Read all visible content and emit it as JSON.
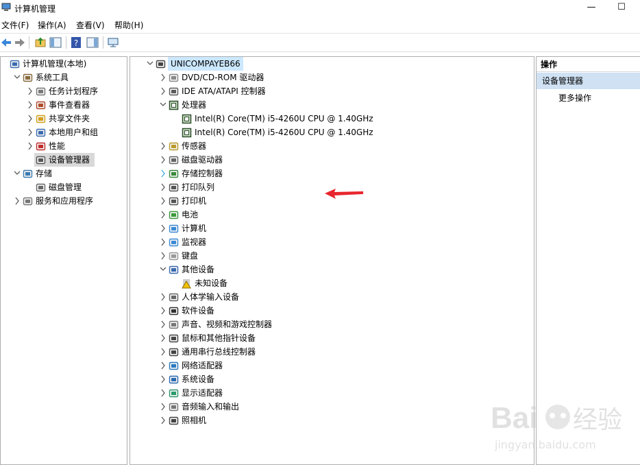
{
  "window": {
    "title": "计算机管理",
    "minimize_glyph": "—",
    "maximize_glyph": "☐"
  },
  "menu": [
    "文件(F)",
    "操作(A)",
    "查看(V)",
    "帮助(H)"
  ],
  "left_tree": [
    {
      "label": "计算机管理(本地)",
      "icon": "computer-management-icon",
      "level": 0,
      "chevron": "none"
    },
    {
      "label": "系统工具",
      "icon": "tools-icon",
      "level": 1,
      "chevron": "down"
    },
    {
      "label": "任务计划程序",
      "icon": "clock-icon",
      "level": 2,
      "chevron": "right"
    },
    {
      "label": "事件查看器",
      "icon": "event-viewer-icon",
      "level": 2,
      "chevron": "right"
    },
    {
      "label": "共享文件夹",
      "icon": "shared-folder-icon",
      "level": 2,
      "chevron": "right"
    },
    {
      "label": "本地用户和组",
      "icon": "users-icon",
      "level": 2,
      "chevron": "right"
    },
    {
      "label": "性能",
      "icon": "performance-icon",
      "level": 2,
      "chevron": "right"
    },
    {
      "label": "设备管理器",
      "icon": "device-manager-icon",
      "level": 2,
      "chevron": "none",
      "selected": true
    },
    {
      "label": "存储",
      "icon": "storage-icon",
      "level": 1,
      "chevron": "down"
    },
    {
      "label": "磁盘管理",
      "icon": "disk-management-icon",
      "level": 2,
      "chevron": "none"
    },
    {
      "label": "服务和应用程序",
      "icon": "services-icon",
      "level": 1,
      "chevron": "right"
    }
  ],
  "device_tree": [
    {
      "label": "UNICOMPAYEB66",
      "icon": "computer-network-icon",
      "level": 0,
      "chevron": "down",
      "host": true
    },
    {
      "label": "DVD/CD-ROM 驱动器",
      "icon": "dvd-icon",
      "level": 1,
      "chevron": "right"
    },
    {
      "label": "IDE ATA/ATAPI 控制器",
      "icon": "ide-controller-icon",
      "level": 1,
      "chevron": "right"
    },
    {
      "label": "处理器",
      "icon": "processor-icon",
      "level": 1,
      "chevron": "down"
    },
    {
      "label": "Intel(R) Core(TM) i5-4260U CPU @ 1.40GHz",
      "icon": "processor-icon",
      "level": 2,
      "chevron": "none"
    },
    {
      "label": "Intel(R) Core(TM) i5-4260U CPU @ 1.40GHz",
      "icon": "processor-icon",
      "level": 2,
      "chevron": "none"
    },
    {
      "label": "传感器",
      "icon": "sensor-icon",
      "level": 1,
      "chevron": "right"
    },
    {
      "label": "磁盘驱动器",
      "icon": "disk-drive-icon",
      "level": 1,
      "chevron": "right"
    },
    {
      "label": "存储控制器",
      "icon": "storage-controller-icon",
      "level": 1,
      "chevron": "right-blue"
    },
    {
      "label": "打印队列",
      "icon": "print-queue-icon",
      "level": 1,
      "chevron": "right"
    },
    {
      "label": "打印机",
      "icon": "printer-icon",
      "level": 1,
      "chevron": "right"
    },
    {
      "label": "电池",
      "icon": "battery-icon",
      "level": 1,
      "chevron": "right"
    },
    {
      "label": "计算机",
      "icon": "monitor-icon",
      "level": 1,
      "chevron": "right"
    },
    {
      "label": "监视器",
      "icon": "monitor-icon",
      "level": 1,
      "chevron": "right"
    },
    {
      "label": "键盘",
      "icon": "keyboard-icon",
      "level": 1,
      "chevron": "right"
    },
    {
      "label": "其他设备",
      "icon": "other-devices-icon",
      "level": 1,
      "chevron": "down"
    },
    {
      "label": "未知设备",
      "icon": "unknown-device-warning-icon",
      "level": 2,
      "chevron": "none"
    },
    {
      "label": "人体学输入设备",
      "icon": "hid-icon",
      "level": 1,
      "chevron": "right"
    },
    {
      "label": "软件设备",
      "icon": "software-device-icon",
      "level": 1,
      "chevron": "right"
    },
    {
      "label": "声音、视频和游戏控制器",
      "icon": "speaker-icon",
      "level": 1,
      "chevron": "right"
    },
    {
      "label": "鼠标和其他指针设备",
      "icon": "mouse-icon",
      "level": 1,
      "chevron": "right"
    },
    {
      "label": "通用串行总线控制器",
      "icon": "usb-icon",
      "level": 1,
      "chevron": "right"
    },
    {
      "label": "网络适配器",
      "icon": "network-adapter-icon",
      "level": 1,
      "chevron": "right"
    },
    {
      "label": "系统设备",
      "icon": "system-device-icon",
      "level": 1,
      "chevron": "right"
    },
    {
      "label": "显示适配器",
      "icon": "display-adapter-icon",
      "level": 1,
      "chevron": "right"
    },
    {
      "label": "音频输入和输出",
      "icon": "speaker-icon",
      "level": 1,
      "chevron": "right"
    },
    {
      "label": "照相机",
      "icon": "camera-icon",
      "level": 1,
      "chevron": "right"
    }
  ],
  "actions": {
    "header": "操作",
    "selected": "设备管理器",
    "more": "更多操作"
  },
  "watermark": {
    "brand_left": "Bai",
    "brand_right": "经验",
    "url": "jingyan.baidu.com"
  },
  "colors": {
    "host_highlight": "#cce8ff",
    "selected_gray": "#d9d9d9",
    "actions_selected": "#cfe1f3",
    "annotation_arrow": "#e8262d"
  }
}
